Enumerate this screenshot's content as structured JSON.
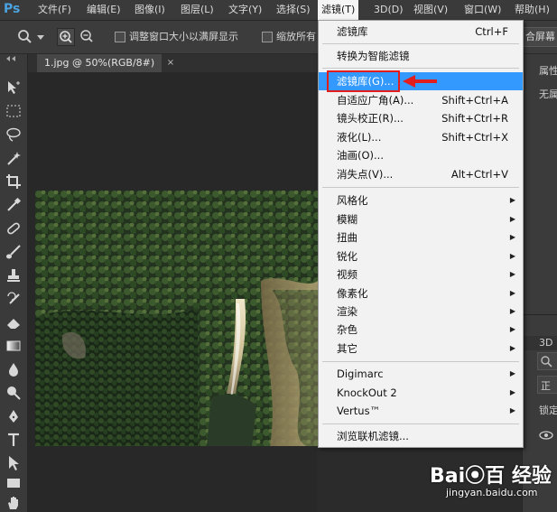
{
  "app": {
    "logo": "Ps"
  },
  "menubar": {
    "items": [
      "文件(F)",
      "编辑(E)",
      "图像(I)",
      "图层(L)",
      "文字(Y)",
      "选择(S)",
      "滤镜(T)",
      "3D(D)",
      "视图(V)",
      "窗口(W)",
      "帮助(H)"
    ]
  },
  "options": {
    "resize_windows_label": "调整窗口大小以满屏显示",
    "zoom_all_label": "缩放所有",
    "fill_screen_label": "合屏幕"
  },
  "document": {
    "tab_title": "1.jpg @ 50%(RGB/8#)",
    "close": "×"
  },
  "right_panel": {
    "properties_label": "属性",
    "none_label": "无属",
    "tab_3d": "3D",
    "field1": "正",
    "lock_label": "锁定"
  },
  "filter_menu": {
    "last_filter": {
      "label": "滤镜库",
      "shortcut": "Ctrl+F"
    },
    "convert_smart": "转换为智能滤镜",
    "items_group1": [
      {
        "label": "滤镜库(G)...",
        "shortcut": ""
      },
      {
        "label": "自适应广角(A)...",
        "shortcut": "Shift+Ctrl+A"
      },
      {
        "label": "镜头校正(R)...",
        "shortcut": "Shift+Ctrl+R"
      },
      {
        "label": "液化(L)...",
        "shortcut": "Shift+Ctrl+X"
      },
      {
        "label": "油画(O)...",
        "shortcut": ""
      },
      {
        "label": "消失点(V)...",
        "shortcut": "Alt+Ctrl+V"
      }
    ],
    "items_group2": [
      "风格化",
      "模糊",
      "扭曲",
      "锐化",
      "视频",
      "像素化",
      "渲染",
      "杂色",
      "其它"
    ],
    "items_group3": [
      "Digimarc",
      "KnockOut 2",
      "Vertus™"
    ],
    "browse_online": "浏览联机滤镜..."
  },
  "watermark": {
    "logo": "Bai⦿百 经验",
    "url": "jingyan.baidu.com"
  },
  "colors": {
    "menu_highlight": "#3399ff",
    "annotation_red": "#e11d1d"
  }
}
